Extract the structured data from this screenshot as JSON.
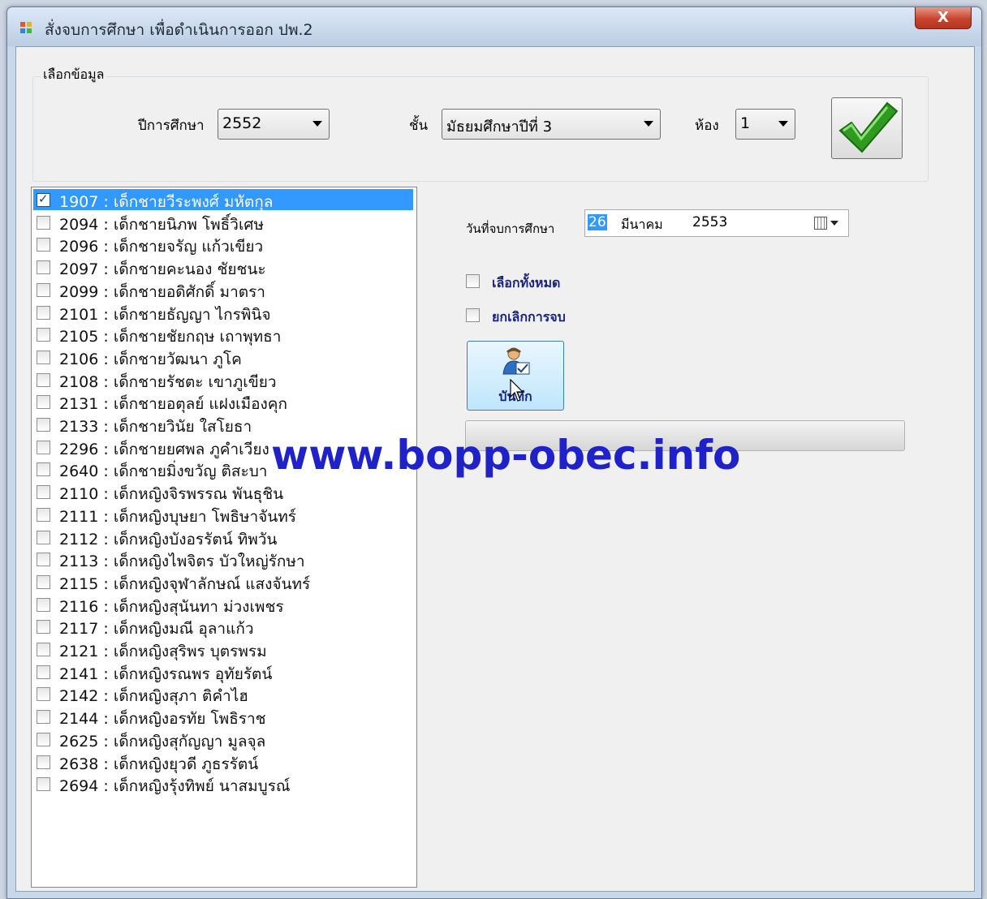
{
  "window": {
    "title": "สั่งจบการศึกษา เพื่อดำเนินการออก ปพ.2",
    "close_glyph": "X"
  },
  "filter": {
    "group_label": "เลือกข้อมูล",
    "year_label": "ปีการศึกษา",
    "year_value": "2552",
    "level_label": "ชั้น",
    "level_value": "มัธยมศึกษาปีที่ 3",
    "room_label": "ห้อง",
    "room_value": "1"
  },
  "students": [
    {
      "text": "1907 : เด็กชายวีระพงศ์ มหัตกุล",
      "checked": true,
      "selected": true
    },
    {
      "text": "2094 : เด็กชายนิภพ โพธิ์วิเศษ",
      "checked": false,
      "selected": false
    },
    {
      "text": "2096 : เด็กชายจรัญ แก้วเขียว",
      "checked": false,
      "selected": false
    },
    {
      "text": "2097 : เด็กชายคะนอง ชัยชนะ",
      "checked": false,
      "selected": false
    },
    {
      "text": "2099 : เด็กชายอดิศักดิ์ มาตรา",
      "checked": false,
      "selected": false
    },
    {
      "text": "2101 : เด็กชายธัญญา ไกรพินิจ",
      "checked": false,
      "selected": false
    },
    {
      "text": "2105 : เด็กชายชัยกฤษ เถาพุทธา",
      "checked": false,
      "selected": false
    },
    {
      "text": "2106 : เด็กชายวัฒนา ภูโค",
      "checked": false,
      "selected": false
    },
    {
      "text": "2108 : เด็กชายรัชตะ เขาภูเขียว",
      "checked": false,
      "selected": false
    },
    {
      "text": "2131 : เด็กชายอตุลย์ แฝงเมืองคุก",
      "checked": false,
      "selected": false
    },
    {
      "text": "2133 : เด็กชายวินัย ใสโยธา",
      "checked": false,
      "selected": false
    },
    {
      "text": "2296 : เด็กชายยศพล ภูคำเวียง",
      "checked": false,
      "selected": false
    },
    {
      "text": "2640 : เด็กชายมิ่งขวัญ ติสะบา",
      "checked": false,
      "selected": false
    },
    {
      "text": "2110 : เด็กหญิงจิรพรรณ พันธุชิน",
      "checked": false,
      "selected": false
    },
    {
      "text": "2111 : เด็กหญิงบุษยา โพธิษาจันทร์",
      "checked": false,
      "selected": false
    },
    {
      "text": "2112 : เด็กหญิงบังอรรัตน์ ทิพวัน",
      "checked": false,
      "selected": false
    },
    {
      "text": "2113 : เด็กหญิงไพจิตร บัวใหญ่รักษา",
      "checked": false,
      "selected": false
    },
    {
      "text": "2115 : เด็กหญิงจุฬาลักษณ์ แสงจันทร์",
      "checked": false,
      "selected": false
    },
    {
      "text": "2116 : เด็กหญิงสุนันทา ม่วงเพชร",
      "checked": false,
      "selected": false
    },
    {
      "text": "2117 : เด็กหญิงมณี อุลาแก้ว",
      "checked": false,
      "selected": false
    },
    {
      "text": "2121 : เด็กหญิงสุริพร บุตรพรม",
      "checked": false,
      "selected": false
    },
    {
      "text": "2141 : เด็กหญิงรณพร อุทัยรัตน์",
      "checked": false,
      "selected": false
    },
    {
      "text": "2142 : เด็กหญิงสุภา ติคำไฮ",
      "checked": false,
      "selected": false
    },
    {
      "text": "2144 : เด็กหญิงอรทัย โพธิราช",
      "checked": false,
      "selected": false
    },
    {
      "text": "2625 : เด็กหญิงสุกัญญา มูลจุล",
      "checked": false,
      "selected": false
    },
    {
      "text": "2638 : เด็กหญิงยุวดี ภูธรรัตน์",
      "checked": false,
      "selected": false
    },
    {
      "text": "2694 : เด็กหญิงรุ้งทิพย์ นาสมบูรณ์",
      "checked": false,
      "selected": false
    }
  ],
  "graduation": {
    "date_label": "วันที่จบการศึกษา",
    "day": "26",
    "month": "มีนาคม",
    "year": "2553",
    "select_all_label": "เลือกทั้งหมด",
    "cancel_graduation_label": "ยกเลิกการจบ",
    "save_label": "บันทึก"
  },
  "watermark": "www.bopp-obec.info",
  "colors": {
    "selection": "#3399ff",
    "checkmark_green": "#2e9a1e",
    "watermark": "#1f21c9"
  }
}
